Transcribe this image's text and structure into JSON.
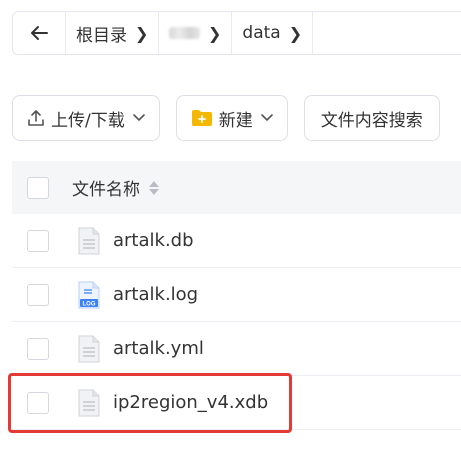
{
  "breadcrumb": {
    "root_label": "根目录",
    "current_label": "data"
  },
  "toolbar": {
    "upload_label": "上传/下载",
    "new_label": "新建",
    "search_label": "文件内容搜索"
  },
  "table": {
    "header_name": "文件名称",
    "rows": [
      {
        "name": "artalk.db",
        "icon": "file-icon"
      },
      {
        "name": "artalk.log",
        "icon": "log-file-icon",
        "icon_text": "LOG"
      },
      {
        "name": "artalk.yml",
        "icon": "file-icon"
      },
      {
        "name": "ip2region_v4.xdb",
        "icon": "file-icon"
      }
    ]
  },
  "colors": {
    "highlight": "#e53935",
    "folder": "#f5b800",
    "log_icon": "#3b82f6"
  }
}
